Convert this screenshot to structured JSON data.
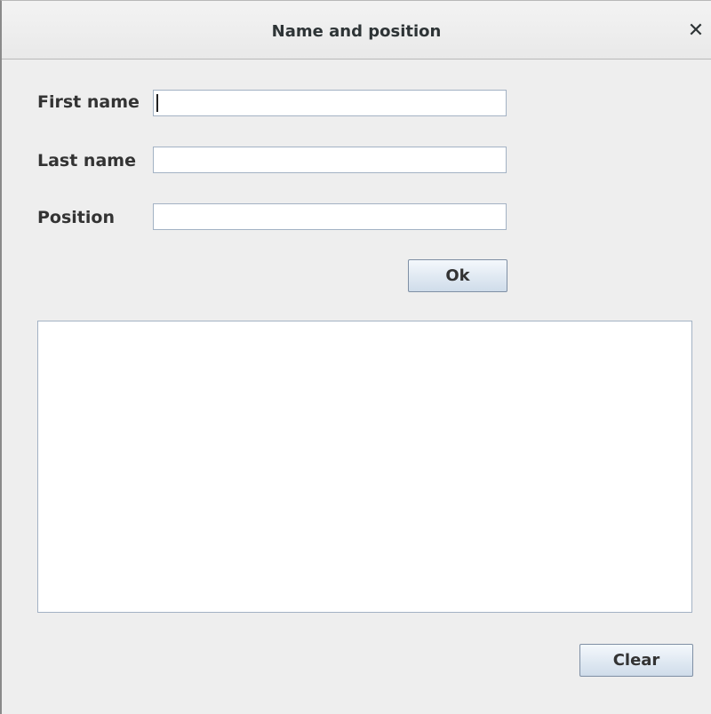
{
  "window": {
    "title": "Name and position",
    "close_icon": "close-icon"
  },
  "form": {
    "first_name": {
      "label": "First name",
      "value": ""
    },
    "last_name": {
      "label": "Last name",
      "value": ""
    },
    "position": {
      "label": "Position",
      "value": ""
    }
  },
  "buttons": {
    "ok_label": "Ok",
    "clear_label": "Clear"
  },
  "output": {
    "text": ""
  }
}
